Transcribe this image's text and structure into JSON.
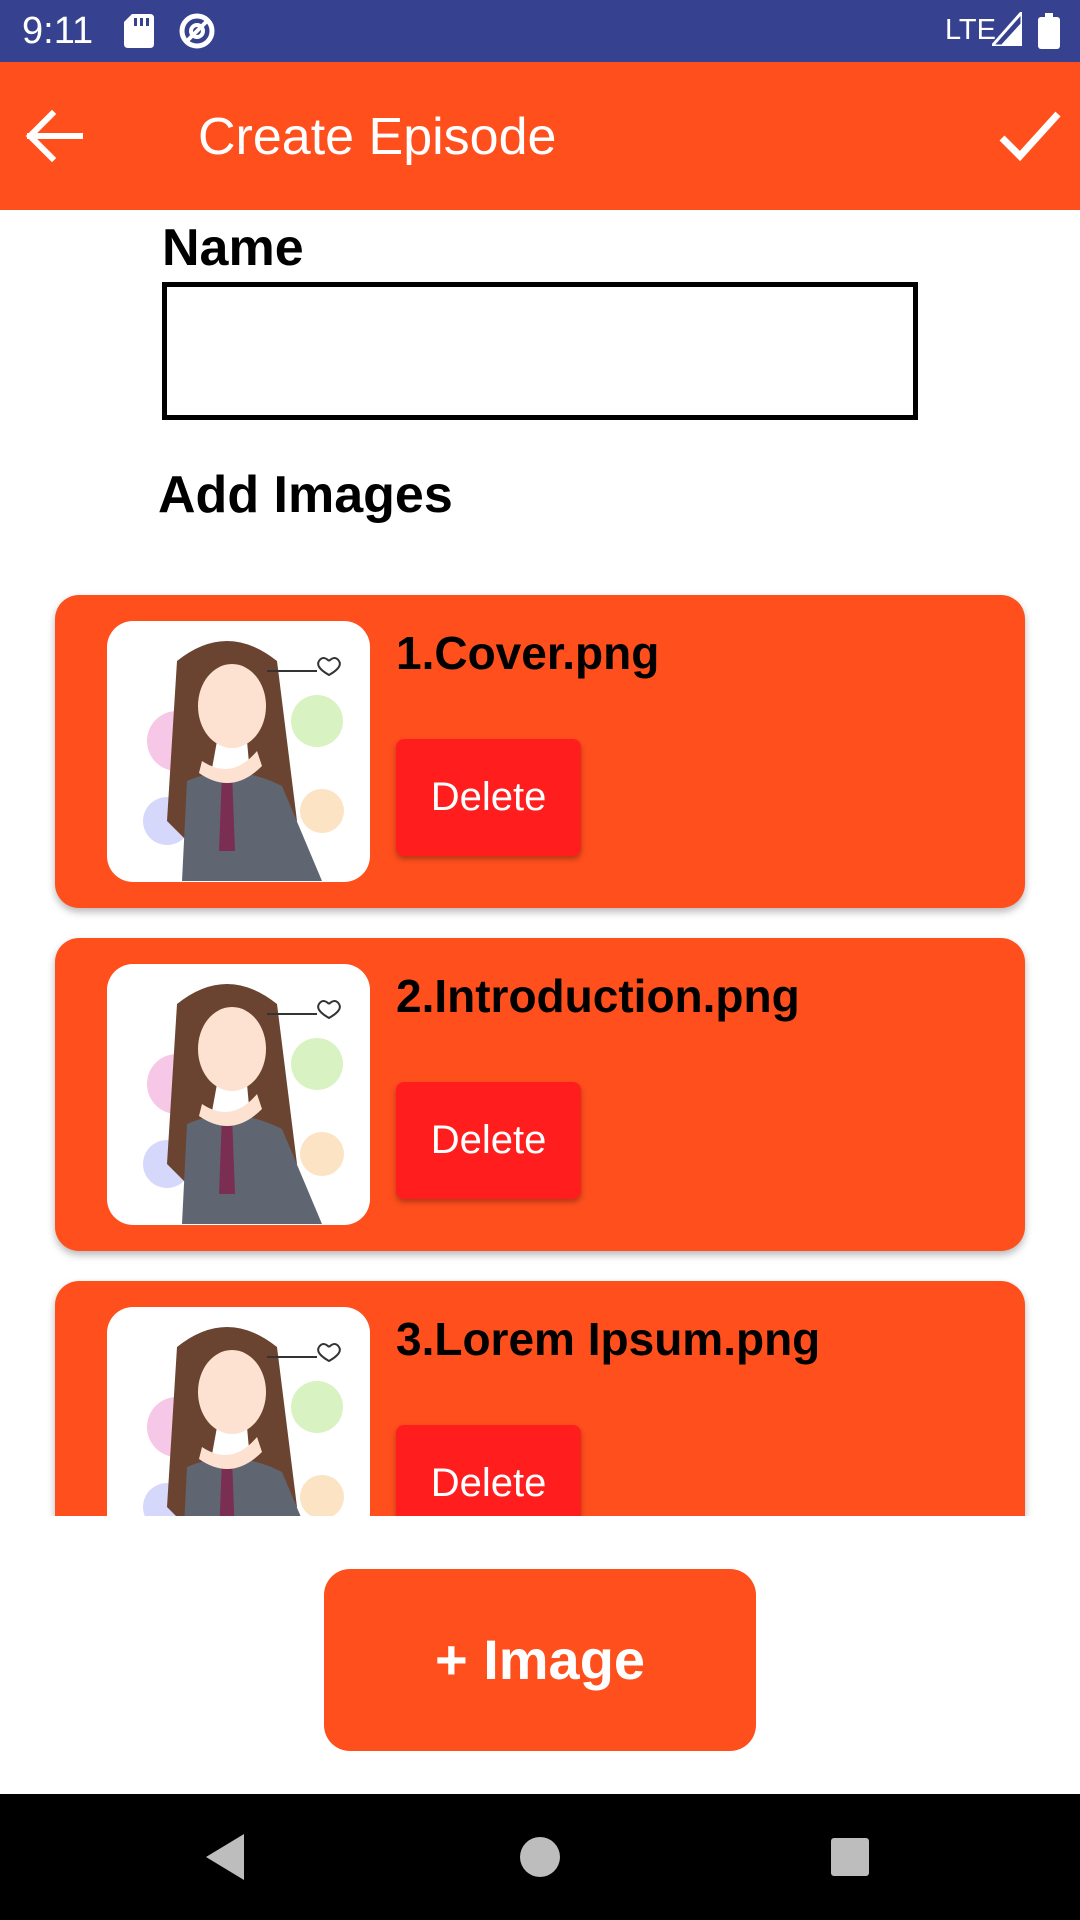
{
  "status_bar": {
    "time": "9:11",
    "network": "LTE",
    "icons": [
      "sd-card-icon",
      "at-sign-icon",
      "signal-icon",
      "battery-icon"
    ],
    "background_color": "#36428f"
  },
  "app_bar": {
    "title": "Create Episode",
    "back_icon": "arrow-left-icon",
    "confirm_icon": "check-icon",
    "background_color": "#ff4f1d"
  },
  "form": {
    "name_label": "Name",
    "name_value": "",
    "name_placeholder": "",
    "add_images_label": "Add Images"
  },
  "images": [
    {
      "file_name": "1.Cover.png",
      "delete_label": "Delete"
    },
    {
      "file_name": "2.Introduction.png",
      "delete_label": "Delete"
    },
    {
      "file_name": "3.Lorem Ipsum.png",
      "delete_label": "Delete"
    }
  ],
  "add_image_button": {
    "label": "+ Image"
  },
  "nav_bar": {
    "icons": [
      "back-triangle-icon",
      "home-circle-icon",
      "recents-square-icon"
    ]
  },
  "colors": {
    "accent": "#ff4f1d",
    "delete": "#ff1d1d",
    "status_bar": "#36428f"
  }
}
